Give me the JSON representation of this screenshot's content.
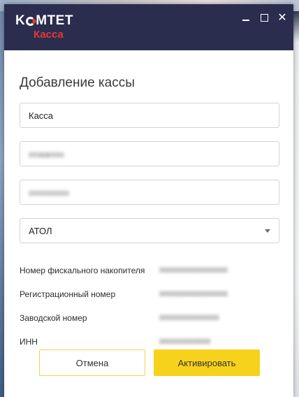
{
  "window": {
    "logo_top": "K MTET",
    "logo_top_left": "K",
    "logo_top_right": "MTET",
    "logo_bottom": "Касса"
  },
  "dialog": {
    "title": "Добавление кассы",
    "fields": {
      "name_value": "Касса",
      "login_value": "ooaaooo",
      "password_value": "oooooooo",
      "model_selected": "АТОЛ"
    },
    "info": [
      {
        "label": "Номер фискального накопителя",
        "value": "0000000000000000"
      },
      {
        "label": "Регистрационный номер",
        "value": "0000000000000000"
      },
      {
        "label": "Заводской номер",
        "value": "00000000000000"
      },
      {
        "label": "ИНН",
        "value": "000000000000"
      }
    ],
    "cancel_label": "Отмена",
    "activate_label": "Активировать"
  },
  "colors": {
    "titlebar": "#2a2d4e",
    "brand_red": "#e53935",
    "accent_yellow": "#f7d21c"
  },
  "icons": {
    "minimize": "minimize-icon",
    "maximize": "maximize-icon",
    "close": "close-icon",
    "dropdown": "chevron-down-icon"
  }
}
